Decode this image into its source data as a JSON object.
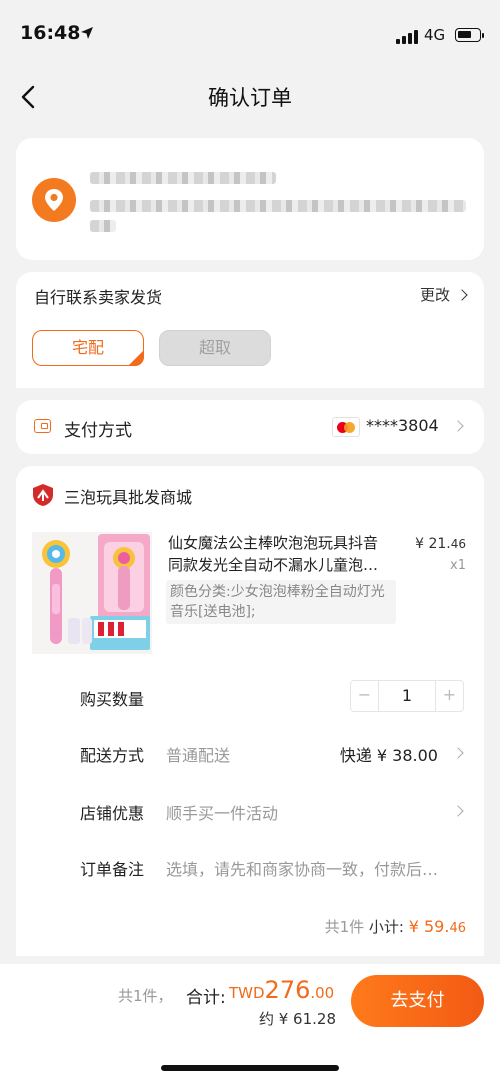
{
  "status_bar": {
    "time": "16:48",
    "network": "4G"
  },
  "nav": {
    "title": "确认订单"
  },
  "delivery": {
    "title": "自行联系卖家发货",
    "change_label": "更改",
    "options": [
      {
        "label": "宅配",
        "selected": true
      },
      {
        "label": "超取",
        "selected": false
      }
    ]
  },
  "payment": {
    "label": "支付方式",
    "card_number": "****3804"
  },
  "shop": {
    "name": "三泡玩具批发商城",
    "product": {
      "title_line1": "仙女魔法公主棒吹泡泡玩具抖音",
      "title_line2": "同款发光全自动不漏水儿童泡…",
      "price_int": "¥ 21.",
      "price_dec": "46",
      "quantity_label": "x1",
      "spec": "颜色分类:少女泡泡棒粉全自动灯光音乐[送电池];"
    },
    "rows": {
      "quantity_label": "购买数量",
      "quantity_minus": "−",
      "quantity_value": "1",
      "quantity_plus": "+",
      "shipping_label": "配送方式",
      "shipping_value": "普通配送",
      "shipping_price": "快递 ¥ 38.00",
      "discount_label": "店铺优惠",
      "discount_value": "顺手买一件活动",
      "note_label": "订单备注",
      "note_placeholder": "选填，请先和商家协商一致，付款后…"
    },
    "subtotal": {
      "count": "共1件",
      "label": "小计:",
      "amount_int": "¥ 59.",
      "amount_dec": "46"
    }
  },
  "bottom_bar": {
    "count": "共1件，",
    "total_label": "合计:",
    "total_currency": "TWD",
    "total_int": "276",
    "total_dec": ".00",
    "approx": "约 ¥ 61.28",
    "pay_button": "去支付"
  },
  "colors": {
    "accent": "#f26a1b",
    "background": "#f2f2f2"
  }
}
